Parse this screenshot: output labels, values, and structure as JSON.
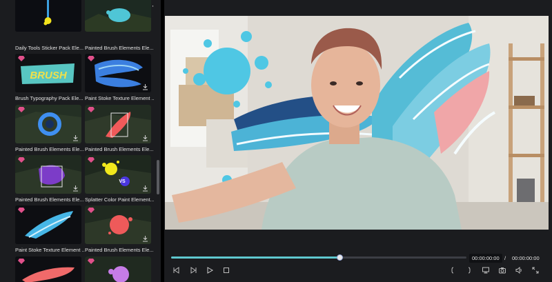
{
  "library": {
    "more_label": "···",
    "items": [
      {
        "label": "Daily Tools Sticker Pack Ele...",
        "premium": false,
        "download": false
      },
      {
        "label": "Painted Brush Elements Ele...",
        "premium": false,
        "download": false
      },
      {
        "label": "Brush Typography Pack Ele...",
        "premium": true,
        "download": false
      },
      {
        "label": "Paint Stoke Texture Element ...",
        "premium": true,
        "download": true
      },
      {
        "label": "Painted Brush Elements Ele...",
        "premium": true,
        "download": true
      },
      {
        "label": "Painted Brush Elements Ele...",
        "premium": true,
        "download": true
      },
      {
        "label": "Painted Brush Elements Ele...",
        "premium": true,
        "download": true
      },
      {
        "label": "Splatter Color Paint Element...",
        "premium": true,
        "download": true
      },
      {
        "label": "Paint Stoke Texture Element ...",
        "premium": true,
        "download": false
      },
      {
        "label": "Painted Brush Elements Ele...",
        "premium": true,
        "download": true
      },
      {
        "label": "",
        "premium": true,
        "download": false
      },
      {
        "label": "",
        "premium": true,
        "download": false
      }
    ],
    "thumb_texts": {
      "brush": "BRUSH",
      "vs": "VS"
    }
  },
  "player": {
    "time_current": "00:00:00:00",
    "time_separator": "/",
    "time_total": "00:00:00:00",
    "progress": 0.57,
    "accent": "#5fc8cf"
  },
  "controls": [
    "prev-frame-icon",
    "play-step-icon",
    "play-icon",
    "stop-icon",
    "mark-in-icon",
    "mark-out-icon",
    "display-icon",
    "snapshot-icon",
    "volume-icon",
    "fullscreen-icon"
  ]
}
